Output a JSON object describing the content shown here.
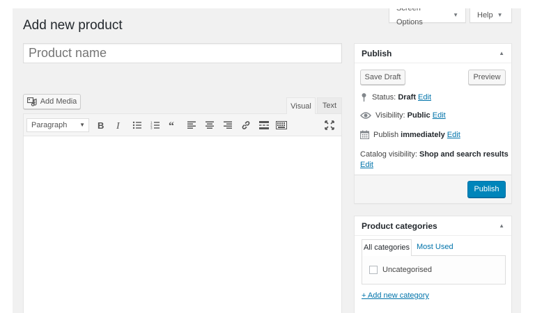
{
  "screen_tabs": {
    "screen_options": "Screen Options",
    "help": "Help"
  },
  "page_title": "Add new product",
  "title_field": {
    "placeholder": "Product name",
    "value": ""
  },
  "add_media_label": "Add Media",
  "editor_tabs": [
    {
      "label": "Visual",
      "active": true
    },
    {
      "label": "Text",
      "active": false
    }
  ],
  "toolbar": {
    "format_select": "Paragraph",
    "buttons": [
      "bold-icon",
      "italic-icon",
      "bulleted-list-icon",
      "numbered-list-icon",
      "blockquote-icon",
      "align-left-icon",
      "align-center-icon",
      "align-right-icon",
      "link-icon",
      "read-more-icon",
      "toolbar-toggle-icon",
      "fullscreen-icon"
    ]
  },
  "publish_box": {
    "title": "Publish",
    "save_draft": "Save Draft",
    "preview": "Preview",
    "status_label": "Status:",
    "status_value": "Draft",
    "visibility_label": "Visibility:",
    "visibility_value": "Public",
    "publish_label": "Publish",
    "publish_value": "immediately",
    "catalog_label": "Catalog visibility:",
    "catalog_value": "Shop and search results",
    "edit": "Edit",
    "publish_button": "Publish"
  },
  "categories_box": {
    "title": "Product categories",
    "tabs": [
      "All categories",
      "Most Used"
    ],
    "items": [
      {
        "label": "Uncategorised",
        "checked": false
      }
    ],
    "add_link": "+ Add new category"
  },
  "colors": {
    "primary": "#0085ba",
    "link": "#0073aa",
    "background": "#f1f1f1"
  }
}
